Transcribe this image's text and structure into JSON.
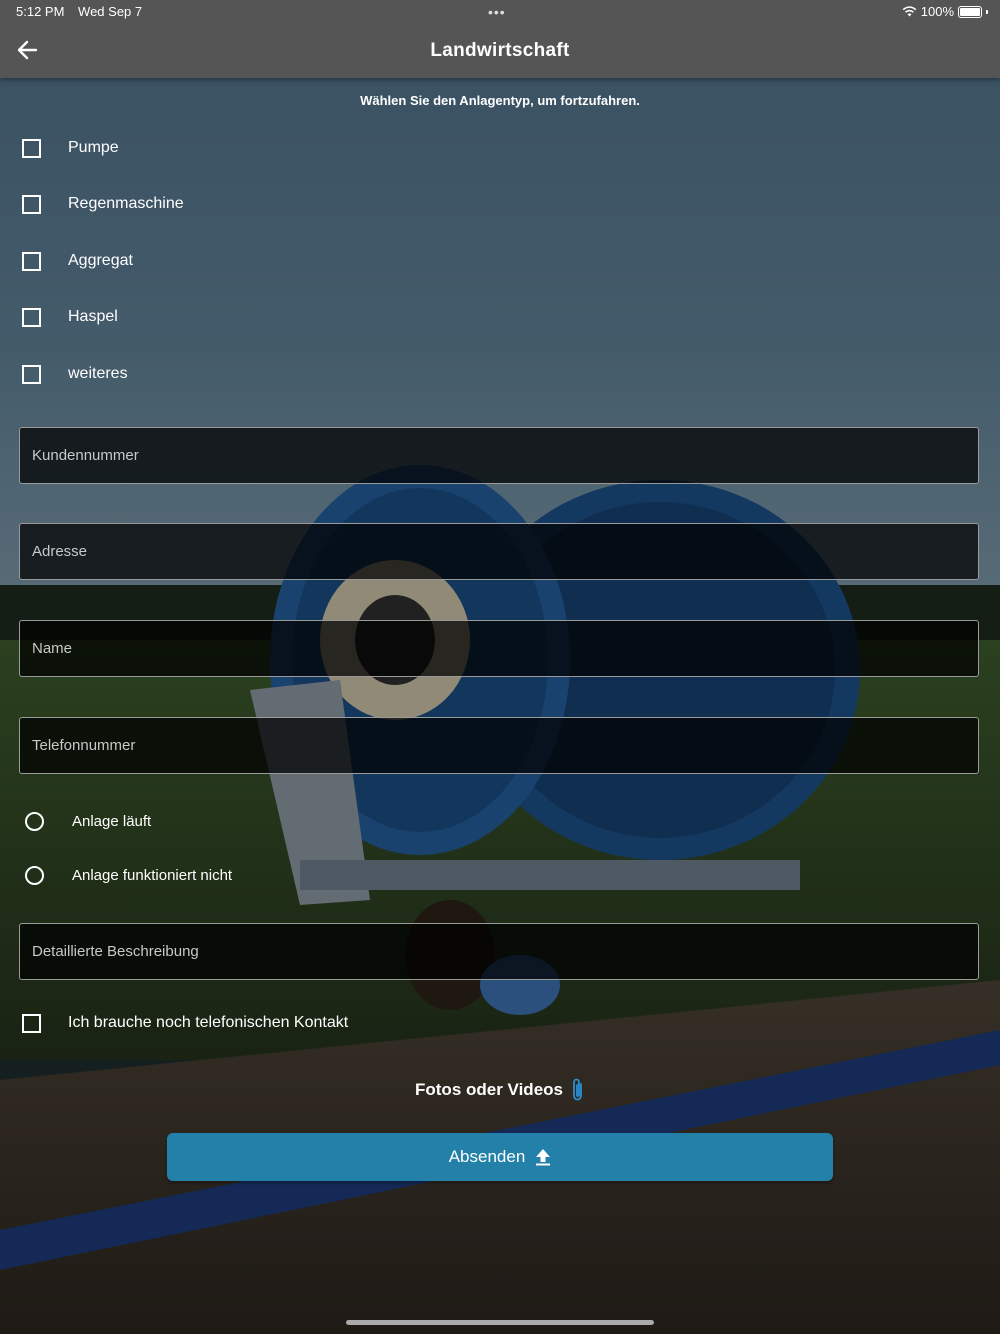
{
  "status_bar": {
    "time": "5:12 PM",
    "date": "Wed Sep 7",
    "dots": "•••",
    "battery": "100%"
  },
  "header": {
    "title": "Landwirtschaft",
    "back_icon": "arrow-left-icon"
  },
  "instruction": "Wählen Sie den Anlagentyp, um fortzufahren.",
  "plant_types": [
    {
      "label": "Pumpe",
      "checked": false
    },
    {
      "label": "Regenmaschine",
      "checked": false
    },
    {
      "label": "Aggregat",
      "checked": false
    },
    {
      "label": "Haspel",
      "checked": false
    },
    {
      "label": "weiteres",
      "checked": false
    }
  ],
  "fields": {
    "customer_number": {
      "placeholder": "Kundennummer",
      "value": ""
    },
    "address": {
      "placeholder": "Adresse",
      "value": ""
    },
    "name": {
      "placeholder": "Name",
      "value": ""
    },
    "phone": {
      "placeholder": "Telefonnummer",
      "value": ""
    },
    "description": {
      "placeholder": "Detaillierte Beschreibung",
      "value": ""
    }
  },
  "status_options": [
    {
      "label": "Anlage läuft",
      "selected": false
    },
    {
      "label": "Anlage funktioniert nicht",
      "selected": false
    }
  ],
  "contact_checkbox": {
    "label": "Ich brauche noch telefonischen Kontakt",
    "checked": false
  },
  "attachment": {
    "label": "Fotos oder Videos",
    "icon": "paperclip-icon",
    "icon_color": "#2a8fd1"
  },
  "submit": {
    "label": "Absenden",
    "icon": "upload-icon",
    "color": "#2380a8"
  },
  "colors": {
    "appbar": "#555555",
    "accent": "#2380a8"
  }
}
